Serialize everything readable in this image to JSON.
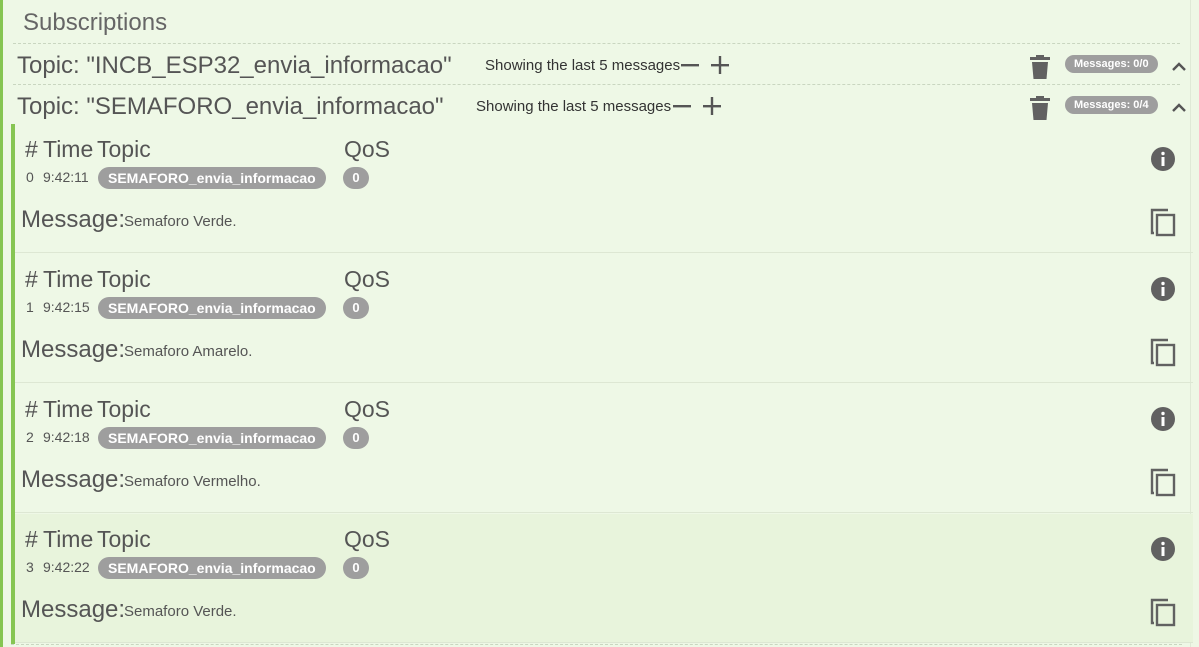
{
  "header": {
    "title": "Subscriptions"
  },
  "subscriptions": [
    {
      "topic": "Topic: \"INCB_ESP32_envia_informacao\"",
      "showing": "Showing the last 5 messages",
      "messages_badge": "Messages: 0/0"
    },
    {
      "topic": "Topic: \"SEMAFORO_envia_informacao\"",
      "showing": "Showing the last 5 messages",
      "messages_badge": "Messages: 0/4"
    }
  ],
  "table_headers": {
    "hash": "#",
    "time": "Time",
    "topic": "Topic",
    "qos": "QoS",
    "message_label": "Message:"
  },
  "messages": [
    {
      "index": "0",
      "time": "9:42:11",
      "topic": "SEMAFORO_envia_informacao",
      "qos": "0",
      "text": "Semaforo Verde."
    },
    {
      "index": "1",
      "time": "9:42:15",
      "topic": "SEMAFORO_envia_informacao",
      "qos": "0",
      "text": "Semaforo Amarelo."
    },
    {
      "index": "2",
      "time": "9:42:18",
      "topic": "SEMAFORO_envia_informacao",
      "qos": "0",
      "text": "Semaforo Vermelho."
    },
    {
      "index": "3",
      "time": "9:42:22",
      "topic": "SEMAFORO_envia_informacao",
      "qos": "0",
      "text": "Semaforo Verde."
    }
  ],
  "icons": [
    "minus-icon",
    "plus-icon",
    "trash-icon",
    "chevron-up-icon",
    "info-icon",
    "copy-icon"
  ],
  "colors": {
    "accent": "#86c552",
    "background": "#eef8e6",
    "badge": "#9e9e9e",
    "icon": "#616161"
  }
}
